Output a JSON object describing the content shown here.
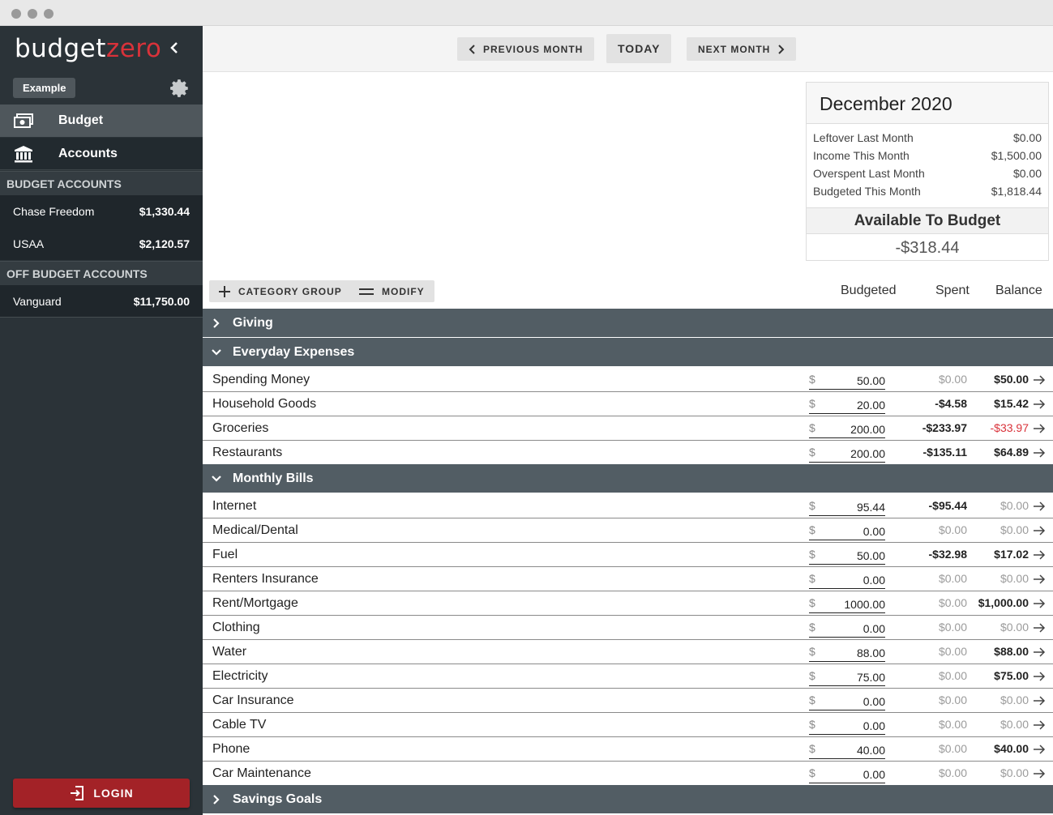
{
  "brand": {
    "part1": "budget",
    "part2": "zero"
  },
  "sidebar": {
    "tag": "Example",
    "nav": [
      {
        "label": "Budget",
        "icon": "money-icon"
      },
      {
        "label": "Accounts",
        "icon": "bank-icon"
      }
    ],
    "budget_accounts_header": "BUDGET ACCOUNTS",
    "budget_accounts": [
      {
        "name": "Chase Freedom",
        "amount": "$1,330.44"
      },
      {
        "name": "USAA",
        "amount": "$2,120.57"
      }
    ],
    "off_budget_header": "OFF BUDGET ACCOUNTS",
    "off_budget_accounts": [
      {
        "name": "Vanguard",
        "amount": "$11,750.00"
      }
    ],
    "login_label": "LOGIN"
  },
  "topbar": {
    "prev_label": "PREVIOUS MONTH",
    "today_label": "TODAY",
    "next_label": "NEXT MONTH"
  },
  "summary": {
    "month": "December 2020",
    "rows": [
      {
        "label": "Leftover Last Month",
        "value": "$0.00"
      },
      {
        "label": "Income This Month",
        "value": "$1,500.00"
      },
      {
        "label": "Overspent Last Month",
        "value": "$0.00"
      },
      {
        "label": "Budgeted This Month",
        "value": "$1,818.44"
      }
    ],
    "available_label": "Available To Budget",
    "available_value": "-$318.44"
  },
  "controls": {
    "category_group_label": "CATEGORY GROUP",
    "modify_label": "MODIFY",
    "col_budgeted": "Budgeted",
    "col_spent": "Spent",
    "col_balance": "Balance"
  },
  "groups": [
    {
      "name": "Giving",
      "expanded": false
    },
    {
      "name": "Everyday Expenses",
      "expanded": true
    },
    {
      "name": "Monthly Bills",
      "expanded": true
    },
    {
      "name": "Savings Goals",
      "expanded": false
    }
  ],
  "categories": [
    {
      "name": "Spending Money",
      "currency": "$",
      "budgeted": "50.00",
      "spent": "$0.00",
      "balance": "$50.00",
      "spent_style": "muted",
      "balance_style": "dark"
    },
    {
      "name": "Household Goods",
      "currency": "$",
      "budgeted": "20.00",
      "spent": "-$4.58",
      "balance": "$15.42",
      "spent_style": "dark",
      "balance_style": "dark"
    },
    {
      "name": "Groceries",
      "currency": "$",
      "budgeted": "200.00",
      "spent": "-$233.97",
      "balance": "-$33.97",
      "spent_style": "dark",
      "balance_style": "neg"
    },
    {
      "name": "Restaurants",
      "currency": "$",
      "budgeted": "200.00",
      "spent": "-$135.11",
      "balance": "$64.89",
      "spent_style": "dark",
      "balance_style": "dark"
    },
    {
      "name": "Internet",
      "currency": "$",
      "budgeted": "95.44",
      "spent": "-$95.44",
      "balance": "$0.00",
      "spent_style": "dark",
      "balance_style": "muted"
    },
    {
      "name": "Medical/Dental",
      "currency": "$",
      "budgeted": "0.00",
      "spent": "$0.00",
      "balance": "$0.00",
      "spent_style": "muted",
      "balance_style": "muted"
    },
    {
      "name": "Fuel",
      "currency": "$",
      "budgeted": "50.00",
      "spent": "-$32.98",
      "balance": "$17.02",
      "spent_style": "dark",
      "balance_style": "dark"
    },
    {
      "name": "Renters Insurance",
      "currency": "$",
      "budgeted": "0.00",
      "spent": "$0.00",
      "balance": "$0.00",
      "spent_style": "muted",
      "balance_style": "muted"
    },
    {
      "name": "Rent/Mortgage",
      "currency": "$",
      "budgeted": "1000.00",
      "spent": "$0.00",
      "balance": "$1,000.00",
      "spent_style": "muted",
      "balance_style": "dark"
    },
    {
      "name": "Clothing",
      "currency": "$",
      "budgeted": "0.00",
      "spent": "$0.00",
      "balance": "$0.00",
      "spent_style": "muted",
      "balance_style": "muted"
    },
    {
      "name": "Water",
      "currency": "$",
      "budgeted": "88.00",
      "spent": "$0.00",
      "balance": "$88.00",
      "spent_style": "muted",
      "balance_style": "dark"
    },
    {
      "name": "Electricity",
      "currency": "$",
      "budgeted": "75.00",
      "spent": "$0.00",
      "balance": "$75.00",
      "spent_style": "muted",
      "balance_style": "dark"
    },
    {
      "name": "Car Insurance",
      "currency": "$",
      "budgeted": "0.00",
      "spent": "$0.00",
      "balance": "$0.00",
      "spent_style": "muted",
      "balance_style": "muted"
    },
    {
      "name": "Cable TV",
      "currency": "$",
      "budgeted": "0.00",
      "spent": "$0.00",
      "balance": "$0.00",
      "spent_style": "muted",
      "balance_style": "muted"
    },
    {
      "name": "Phone",
      "currency": "$",
      "budgeted": "40.00",
      "spent": "$0.00",
      "balance": "$40.00",
      "spent_style": "muted",
      "balance_style": "dark"
    },
    {
      "name": "Car Maintenance",
      "currency": "$",
      "budgeted": "0.00",
      "spent": "$0.00",
      "balance": "$0.00",
      "spent_style": "muted",
      "balance_style": "muted"
    }
  ],
  "colors": {
    "accent": "#d9323a",
    "sidebar": "#2b3338",
    "group": "#525d64"
  }
}
